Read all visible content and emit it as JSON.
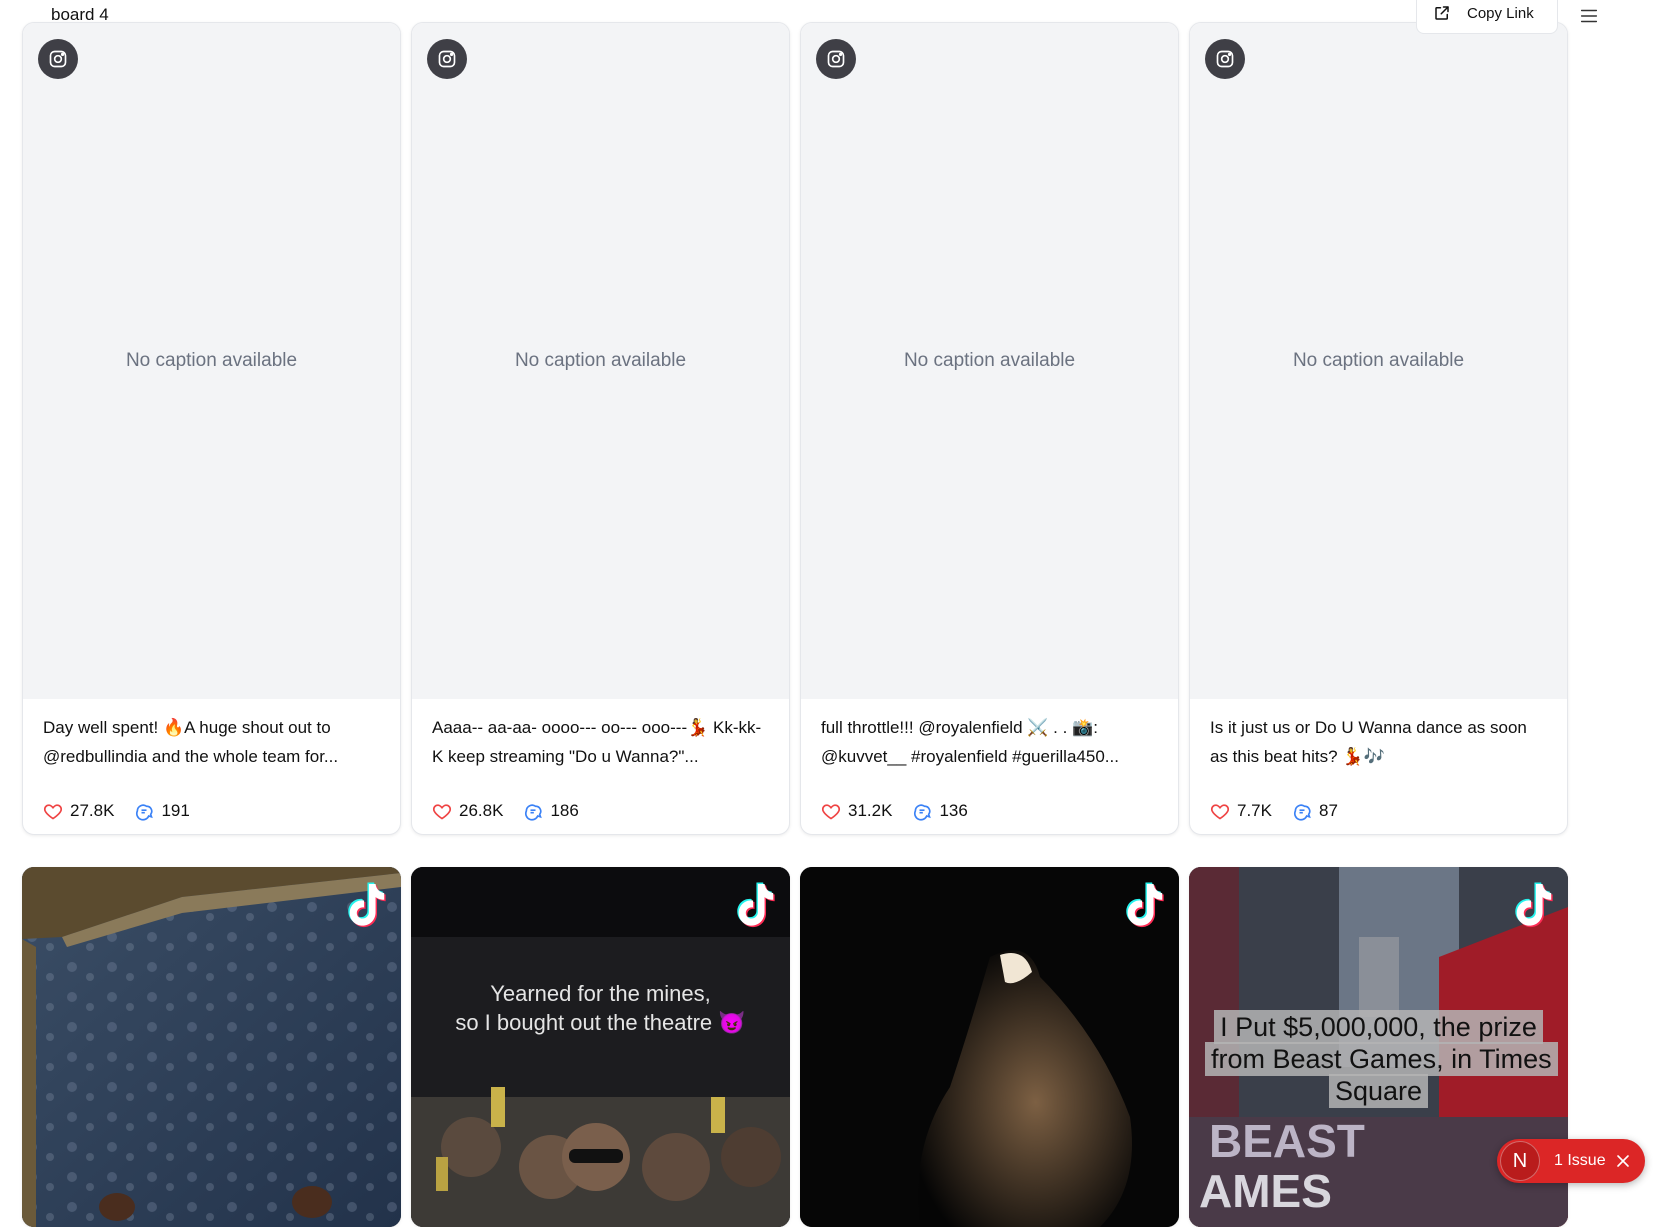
{
  "header": {
    "board_title": "board 4",
    "copy_link_label": "Copy Link"
  },
  "posts_top": [
    {
      "platform": "instagram",
      "placeholder": "No caption available",
      "caption": "Day well spent! 🔥A huge shout out to @redbullindia and the whole team for...",
      "likes": "27.8K",
      "comments": "191"
    },
    {
      "platform": "instagram",
      "placeholder": "No caption available",
      "caption": "Aaaa-- aa-aa- oooo--- oo--- ooo---💃 Kk-kk-K keep streaming \"Do u Wanna?\"...",
      "likes": "26.8K",
      "comments": "186"
    },
    {
      "platform": "instagram",
      "placeholder": "No caption available",
      "caption": "full throttle!!! @royalenfield ⚔️ . . 📸: @kuvvet__ #royalenfield #guerilla450...",
      "likes": "31.2K",
      "comments": "136"
    },
    {
      "platform": "instagram",
      "placeholder": "No caption available",
      "caption": "Is it just us or Do U Wanna dance as soon as this beat hits? 💃🎶",
      "likes": "7.7K",
      "comments": "87"
    }
  ],
  "posts_bottom": [
    {
      "platform": "tiktok",
      "overlay": ""
    },
    {
      "platform": "tiktok",
      "overlay_line1": "Yearned for the mines,",
      "overlay_line2": "so I bought out the theatre 😈"
    },
    {
      "platform": "tiktok",
      "overlay": ""
    },
    {
      "platform": "tiktok",
      "overlay_boxed": "I Put $5,000,000, the prize from Beast Games, in Times Square"
    }
  ],
  "issue_badge": {
    "initial": "N",
    "label": "1 Issue"
  },
  "colors": {
    "accent_red": "#dc2626",
    "comment_blue": "#3b82f6",
    "heart_red": "#ef4444"
  }
}
